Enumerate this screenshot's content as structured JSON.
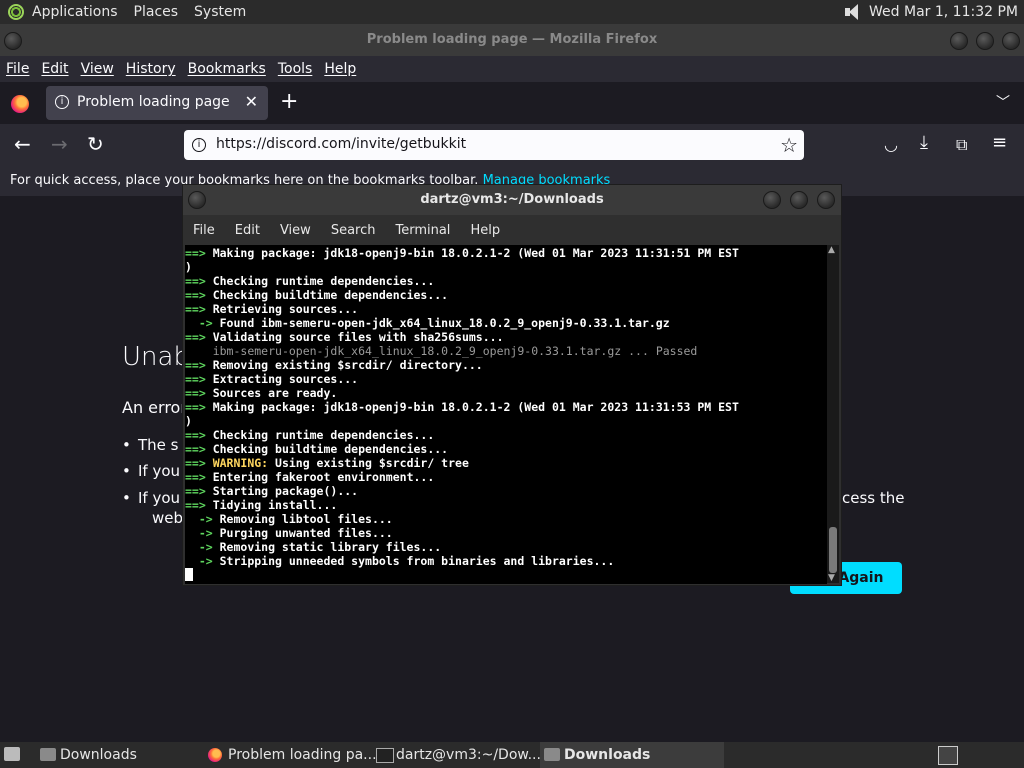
{
  "top_panel": {
    "menus": [
      "Applications",
      "Places",
      "System"
    ],
    "clock": "Wed Mar 1, 11:32 PM"
  },
  "firefox": {
    "window_title": "Problem loading page — Mozilla Firefox",
    "menubar": [
      "File",
      "Edit",
      "View",
      "History",
      "Bookmarks",
      "Tools",
      "Help"
    ],
    "tab_title": "Problem loading page",
    "url": "https://discord.com/invite/getbukkit",
    "bookmarks_bar_text": "For quick access, place your bookmarks here on the bookmarks toolbar.",
    "bookmarks_bar_link": "Manage bookmarks",
    "error_page": {
      "title_visible": "Unab",
      "desc_visible": "An error",
      "bullet1_visible": "The s",
      "bullet2_visible": "If you",
      "bullet3_visible": "If you",
      "bullet3_tail": "cess the",
      "bullet3_line2": "web",
      "try_again": "Again"
    }
  },
  "terminal": {
    "title": "dartz@vm3:~/Downloads",
    "menu": [
      "File",
      "Edit",
      "View",
      "Search",
      "Terminal",
      "Help"
    ],
    "lines": [
      {
        "prefix": "==> ",
        "text": "Making package: jdk18-openj9-bin 18.0.2.1-2 (Wed 01 Mar 2023 11:31:51 PM EST"
      },
      {
        "prefix": "",
        "text": ")"
      },
      {
        "prefix": "==> ",
        "text": "Checking runtime dependencies..."
      },
      {
        "prefix": "==> ",
        "text": "Checking buildtime dependencies..."
      },
      {
        "prefix": "==> ",
        "text": "Retrieving sources..."
      },
      {
        "prefix": "  -> ",
        "text": "Found ibm-semeru-open-jdk_x64_linux_18.0.2_9_openj9-0.33.1.tar.gz"
      },
      {
        "prefix": "==> ",
        "text": "Validating source files with sha256sums..."
      },
      {
        "prefix": "    ",
        "text": "ibm-semeru-open-jdk_x64_linux_18.0.2_9_openj9-0.33.1.tar.gz ... Passed",
        "style": "dim"
      },
      {
        "prefix": "==> ",
        "text": "Removing existing $srcdir/ directory..."
      },
      {
        "prefix": "==> ",
        "text": "Extracting sources..."
      },
      {
        "prefix": "==> ",
        "text": "Sources are ready."
      },
      {
        "prefix": "==> ",
        "text": "Making package: jdk18-openj9-bin 18.0.2.1-2 (Wed 01 Mar 2023 11:31:53 PM EST"
      },
      {
        "prefix": "",
        "text": ")"
      },
      {
        "prefix": "==> ",
        "text": "Checking runtime dependencies..."
      },
      {
        "prefix": "==> ",
        "text": "Checking buildtime dependencies..."
      },
      {
        "prefix": "==> ",
        "warn": "WARNING:",
        "text": " Using existing $srcdir/ tree"
      },
      {
        "prefix": "==> ",
        "text": "Entering fakeroot environment..."
      },
      {
        "prefix": "==> ",
        "text": "Starting package()..."
      },
      {
        "prefix": "==> ",
        "text": "Tidying install..."
      },
      {
        "prefix": "  -> ",
        "text": "Removing libtool files..."
      },
      {
        "prefix": "  -> ",
        "text": "Purging unwanted files..."
      },
      {
        "prefix": "  -> ",
        "text": "Removing static library files..."
      },
      {
        "prefix": "  -> ",
        "text": "Stripping unneeded symbols from binaries and libraries..."
      }
    ]
  },
  "taskbar": {
    "items": [
      "Downloads",
      "Problem loading pa...",
      "dartz@vm3:~/Dow...",
      "Downloads"
    ]
  },
  "colors": {
    "accent": "#00ddff",
    "arrow_green": "#5fd75f",
    "warning_yellow": "#ffd75f"
  }
}
